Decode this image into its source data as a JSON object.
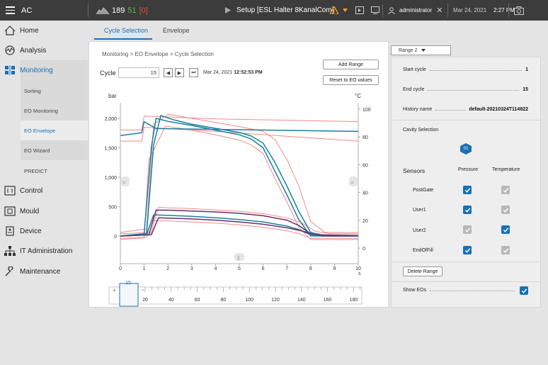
{
  "topbar": {
    "app_title": "AC",
    "count_total": "189",
    "count_good": "51",
    "count_bracket_open": "[",
    "count_bad": "0",
    "count_bracket_close": "]",
    "setup_label": "Setup [ESL Halter 8KanalCom]",
    "user": "administrator",
    "date": "Mar 24, 2021",
    "time": "2:27 PM"
  },
  "sidebar": {
    "items": [
      {
        "label": "Home",
        "icon": "home-icon"
      },
      {
        "label": "Analysis",
        "icon": "analysis-icon"
      },
      {
        "label": "Monitoring",
        "icon": "monitoring-icon"
      },
      {
        "label": "Control",
        "icon": "control-icon"
      },
      {
        "label": "Mould",
        "icon": "mould-icon"
      },
      {
        "label": "Device",
        "icon": "device-icon"
      },
      {
        "label": "IT Administration",
        "icon": "network-icon"
      },
      {
        "label": "Maintenance",
        "icon": "wrench-icon"
      }
    ],
    "subitems": [
      "Sorting",
      "EO Monitoring",
      "EO Envelope",
      "EO Wizard",
      "PREDICT"
    ]
  },
  "tabs": [
    "Cycle Selection",
    "Envelope"
  ],
  "breadcrumb": "Monitoring > EO Envelope > Cycle Selection",
  "buttons": {
    "add_range": "Add Range",
    "reset": "Reset to EO values",
    "delete_range": "Delete Range"
  },
  "cycle": {
    "label": "Cycle",
    "value": "15",
    "date": "Mar 24, 2021",
    "time": "12:52:53 PM"
  },
  "range_select": "Range 2",
  "details": {
    "start_cycle_label": "Start cycle",
    "start_cycle": "1",
    "end_cycle_label": "End cycle",
    "end_cycle": "15",
    "history_label": "History name",
    "history": "default-20210324T114822"
  },
  "cavity": {
    "label": "Cavity Selection",
    "value": "01"
  },
  "sensors": {
    "label": "Sensors",
    "col_pressure": "Pressure",
    "col_temperature": "Temperature",
    "rows": [
      {
        "name": "PostGate",
        "pressure": "checked",
        "temperature": "disabled"
      },
      {
        "name": "User1",
        "pressure": "checked",
        "temperature": "disabled"
      },
      {
        "name": "User2",
        "pressure": "disabled",
        "temperature": "checked"
      },
      {
        "name": "EndOfFill",
        "pressure": "checked",
        "temperature": "disabled"
      }
    ]
  },
  "show_eos": {
    "label": "Show EOs",
    "checked": true
  },
  "colors": {
    "accent": "#1a6fb5",
    "teal": "#1a7fa0",
    "purple": "#6a2d6a",
    "envelope": "#f08a8a"
  },
  "chart_data": {
    "type": "line",
    "ylabel": "bar",
    "y2label": "°C",
    "xlabel": "s",
    "xlim": [
      0,
      10
    ],
    "ylim": [
      0,
      2000
    ],
    "y2lim": [
      0,
      100
    ],
    "xticks": [
      "0",
      "1",
      "2",
      "3",
      "4",
      "5",
      "6",
      "7",
      "8",
      "9",
      "10"
    ],
    "yticks": [
      "0",
      "500",
      "1,000",
      "1,500",
      "2,000"
    ],
    "y2ticks": [
      "0",
      "20",
      "40",
      "60",
      "80",
      "100"
    ],
    "series": [
      {
        "axis": "y2",
        "color": "teal",
        "x": [
          0,
          0.9,
          1.0,
          1.5,
          10
        ],
        "y": [
          81,
          83,
          91,
          86,
          84
        ]
      },
      {
        "axis": "y",
        "color": "teal",
        "x": [
          0,
          1.0,
          1.3,
          1.5,
          2.0,
          3,
          4,
          5,
          5.5,
          6,
          6.5,
          7,
          7.5,
          8,
          8.5,
          10
        ],
        "y": [
          0,
          40,
          1500,
          2000,
          1950,
          1880,
          1800,
          1720,
          1650,
          1500,
          1100,
          700,
          280,
          0,
          0,
          0
        ]
      },
      {
        "axis": "y",
        "color": "teal",
        "x": [
          0,
          1.1,
          1.4,
          1.7,
          2.2,
          3,
          4,
          5,
          5.5,
          6,
          6.5,
          7,
          7.5,
          8,
          8.7,
          10
        ],
        "y": [
          0,
          40,
          1550,
          2050,
          1980,
          1900,
          1830,
          1760,
          1700,
          1580,
          1250,
          850,
          420,
          60,
          0,
          0
        ]
      },
      {
        "axis": "y",
        "color": "purple",
        "x": [
          0,
          1.2,
          1.5,
          2,
          3,
          4,
          5,
          6,
          7,
          7.5,
          8,
          8.5,
          10
        ],
        "y": [
          0,
          20,
          440,
          440,
          425,
          410,
          385,
          345,
          270,
          180,
          40,
          0,
          0
        ]
      },
      {
        "axis": "y",
        "color": "teal",
        "x": [
          0,
          1.1,
          1.4,
          2,
          3,
          4,
          5,
          6,
          7,
          7.5,
          8,
          10
        ],
        "y": [
          0,
          20,
          360,
          350,
          335,
          310,
          280,
          240,
          170,
          110,
          20,
          0
        ]
      },
      {
        "axis": "y",
        "color": "purple",
        "x": [
          0,
          1.3,
          1.6,
          2,
          3,
          4,
          5,
          6,
          7,
          7.7,
          8.2,
          10
        ],
        "y": [
          0,
          20,
          310,
          305,
          290,
          270,
          240,
          200,
          140,
          80,
          20,
          10
        ]
      }
    ],
    "envelope": [
      {
        "x": [
          0,
          0.9,
          1.0,
          4,
          10
        ],
        "y2": [
          85,
          85,
          95,
          93,
          91
        ]
      },
      {
        "x": [
          0,
          0.9,
          1.0,
          4,
          10
        ],
        "y2": [
          77,
          77,
          87,
          84,
          77
        ]
      },
      {
        "x": [
          0,
          1.1,
          1.4,
          2,
          3,
          4,
          5,
          6,
          6.5,
          7,
          7.5,
          8,
          8.6,
          10
        ],
        "y": [
          60,
          120,
          1900,
          2070,
          2000,
          1930,
          1860,
          1780,
          1640,
          1300,
          850,
          250,
          60,
          60
        ]
      },
      {
        "x": [
          0,
          1.0,
          1.2,
          1.9,
          3,
          4,
          5,
          5.5,
          6,
          6.5,
          7,
          7.5,
          8,
          10
        ],
        "y": [
          -60,
          -30,
          1300,
          1870,
          1800,
          1720,
          1630,
          1550,
          1400,
          980,
          580,
          150,
          -60,
          -60
        ]
      },
      {
        "x": [
          0,
          1.3,
          1.6,
          2,
          3,
          4,
          5,
          6,
          7,
          7.6,
          8.2,
          8.8,
          10
        ],
        "y": [
          40,
          60,
          490,
          480,
          465,
          445,
          420,
          380,
          310,
          230,
          80,
          40,
          40
        ]
      },
      {
        "x": [
          0,
          1.1,
          1.3,
          2,
          3,
          4,
          5,
          6,
          7,
          7.5,
          8,
          10
        ],
        "y": [
          -40,
          -20,
          260,
          255,
          240,
          220,
          190,
          150,
          90,
          40,
          -40,
          -40
        ]
      }
    ]
  },
  "timeline": {
    "marker": "15",
    "labels": [
      "20",
      "40",
      "60",
      "80",
      "100",
      "120",
      "140",
      "160",
      "180"
    ],
    "plus": "+",
    "minus": "−"
  }
}
